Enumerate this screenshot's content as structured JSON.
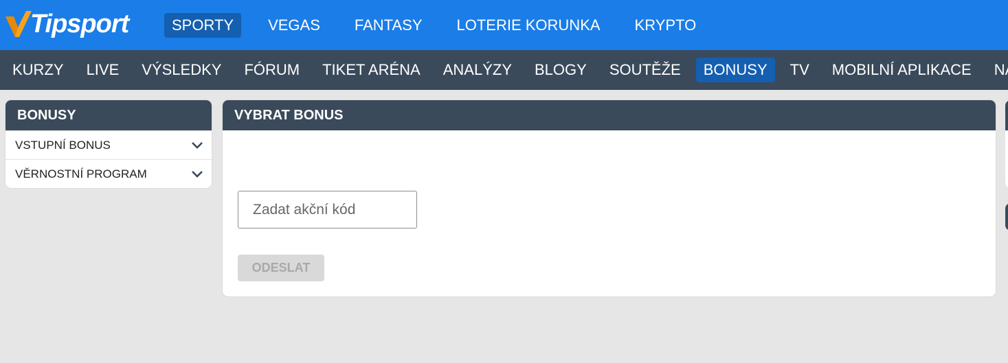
{
  "brand": {
    "name": "Tipsport",
    "accent": "#1a7de8",
    "logo_mark": "#f7a21b"
  },
  "top_nav": [
    {
      "label": "SPORTY",
      "active": true
    },
    {
      "label": "VEGAS"
    },
    {
      "label": "FANTASY"
    },
    {
      "label": "LOTERIE KORUNKA"
    },
    {
      "label": "KRYPTO"
    }
  ],
  "sub_nav": [
    {
      "label": "KURZY"
    },
    {
      "label": "LIVE"
    },
    {
      "label": "VÝSLEDKY"
    },
    {
      "label": "FÓRUM"
    },
    {
      "label": "TIKET ARÉNA"
    },
    {
      "label": "ANALÝZY"
    },
    {
      "label": "BLOGY"
    },
    {
      "label": "SOUTĚŽE"
    },
    {
      "label": "BONUSY",
      "active": true
    },
    {
      "label": "TV"
    },
    {
      "label": "MOBILNÍ APLIKACE"
    },
    {
      "label": "NÁPADY"
    }
  ],
  "sidebar": {
    "title": "BONUSY",
    "items": [
      {
        "label": "VSTUPNÍ BONUS",
        "icon": "chevron-down-icon"
      },
      {
        "label": "VĚRNOSTNÍ PROGRAM",
        "icon": "chevron-down-icon"
      }
    ]
  },
  "main": {
    "title": "VYBRAT BONUS",
    "code_input": {
      "value": "",
      "placeholder": "Zadat akční kód"
    },
    "submit_label": "ODESLAT"
  }
}
